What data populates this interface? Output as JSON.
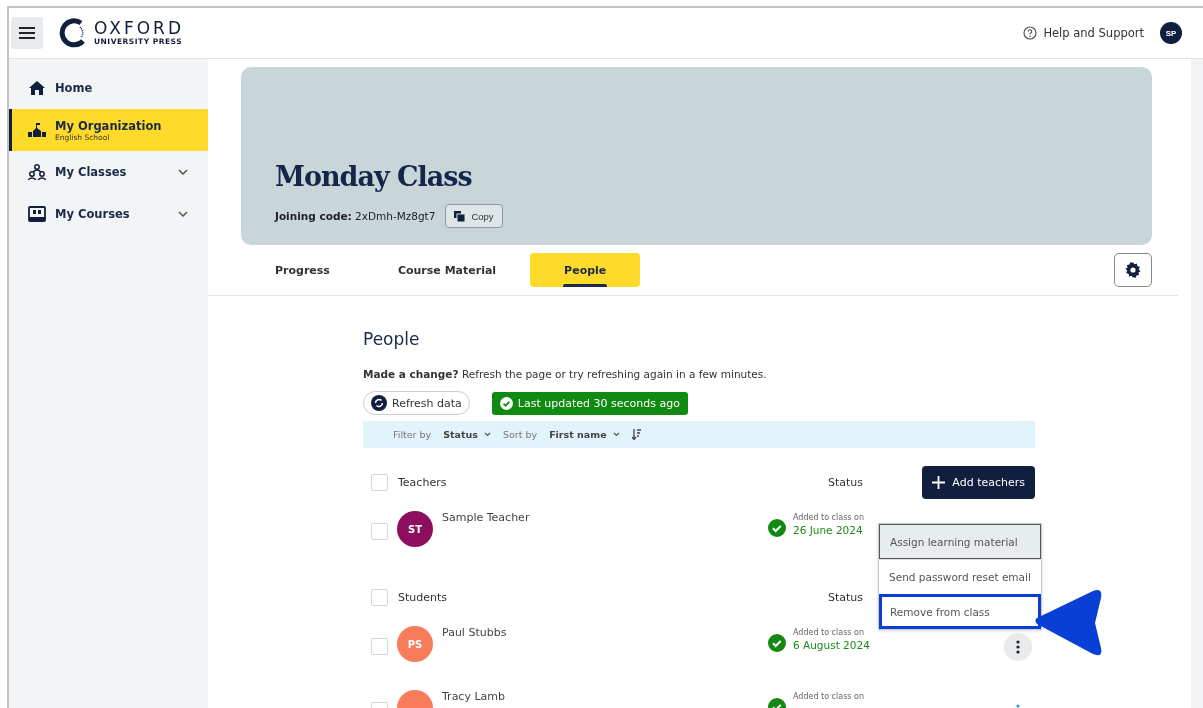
{
  "header": {
    "logo_name": "OXFORD",
    "logo_sub": "UNIVERSITY PRESS",
    "help": "Help and Support",
    "avatar": "SP"
  },
  "sidebar": {
    "items": [
      {
        "label": "Home",
        "kind": "link",
        "selected": false
      },
      {
        "label": "My Organization",
        "sublabel": "English School",
        "kind": "link",
        "selected": true
      },
      {
        "label": "My Classes",
        "kind": "group",
        "selected": false,
        "expanded": false
      },
      {
        "label": "My Courses",
        "kind": "group",
        "selected": false,
        "expanded": false
      }
    ]
  },
  "banner": {
    "title": "Monday Class",
    "code_label": "Joining code:",
    "code": "2xDmh-Mz8gt7",
    "copy": "Copy"
  },
  "tabs": [
    {
      "label": "Progress",
      "selected": false
    },
    {
      "label": "Course Material",
      "selected": false
    },
    {
      "label": "People",
      "selected": true
    }
  ],
  "people": {
    "title": "People",
    "notice_bold": "Made a change?",
    "notice": "Refresh the page or try refreshing again in a few minutes.",
    "refresh": "Refresh data",
    "updated": "Last updated 30 seconds ago",
    "filter_label": "Filter by",
    "filter": "Status",
    "sort_label": "Sort by",
    "sort": "First name",
    "sections": [
      {
        "title": "Teachers",
        "checked": false,
        "status": "Status",
        "button": "Add teachers",
        "members": [
          {
            "initials": "ST",
            "name": "Sample Teacher",
            "color": "#8e0e5e",
            "checked": false,
            "added": "Added to class on",
            "date": "26 June 2024"
          }
        ]
      },
      {
        "title": "Students",
        "checked": false,
        "status": "Status",
        "members": [
          {
            "initials": "PS",
            "name": "Paul Stubbs",
            "color": "#f87b5a",
            "checked": false,
            "added": "Added to class on",
            "date": "6 August 2024",
            "menu_open": true
          },
          {
            "name": "Tracy Lamb",
            "color": "#f87b5a",
            "checked": false,
            "added": "Added to class on",
            "menu_open": false
          }
        ]
      }
    ],
    "menu": [
      {
        "label": "Assign learning material",
        "focused": true,
        "highlighted": false
      },
      {
        "label": "Send password reset email",
        "focused": false,
        "highlighted": false
      },
      {
        "label": "Remove from class",
        "focused": false,
        "highlighted": true
      }
    ]
  }
}
